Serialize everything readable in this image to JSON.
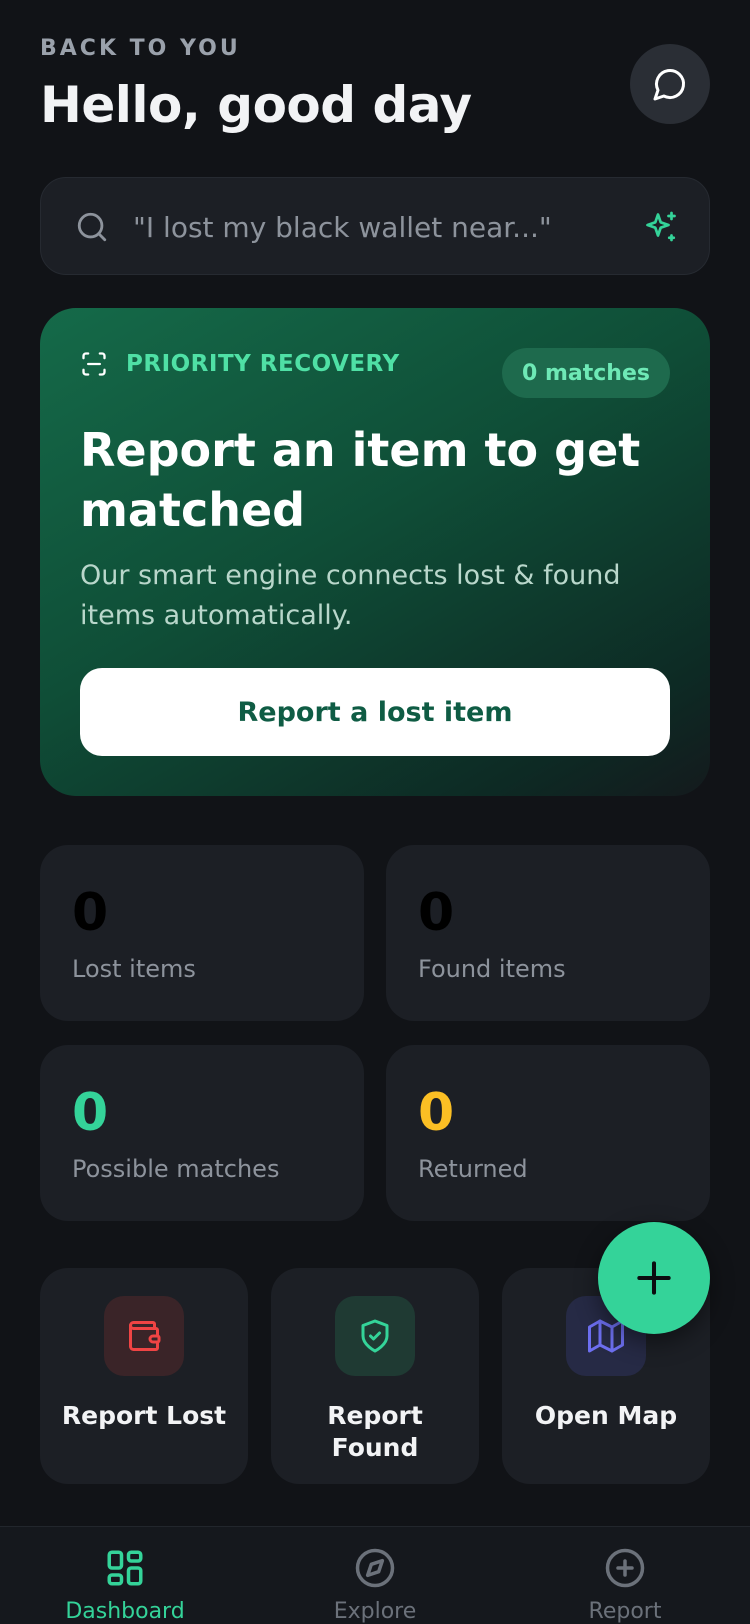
{
  "header": {
    "eyebrow": "BACK TO YOU",
    "title": "Hello, good day",
    "chat_icon": "chat-bubble-icon"
  },
  "search": {
    "placeholder": "\"I lost my black wallet near...\"",
    "search_icon": "search-icon",
    "ai_icon": "sparkle-icon"
  },
  "hero": {
    "tag_icon": "scan-frame-icon",
    "tag_label": "PRIORITY RECOVERY",
    "badge": "0 matches",
    "title": "Report an item to get matched",
    "subtitle": "Our smart engine connects lost & found items automatically.",
    "cta_label": "Report a lost item"
  },
  "stats": [
    {
      "value": "0",
      "label": "Lost items",
      "color": "#000000"
    },
    {
      "value": "0",
      "label": "Found items",
      "color": "#000000"
    },
    {
      "value": "0",
      "label": "Possible matches",
      "color": "#34d399"
    },
    {
      "value": "0",
      "label": "Returned",
      "color": "#fbbf24"
    }
  ],
  "actions": [
    {
      "label": "Report Lost",
      "icon": "wallet-icon",
      "tint": "#3a2428",
      "icon_color": "#ef4444"
    },
    {
      "label": "Report Found",
      "icon": "shield-check-icon",
      "tint": "#1f3a33",
      "icon_color": "#34d399"
    },
    {
      "label": "Open Map",
      "icon": "map-icon",
      "tint": "#262a45",
      "icon_color": "#6d6ff0"
    }
  ],
  "fab": {
    "icon": "plus-icon"
  },
  "nav": [
    {
      "label": "Dashboard",
      "icon": "grid-icon",
      "active": true
    },
    {
      "label": "Explore",
      "icon": "compass-icon",
      "active": false
    },
    {
      "label": "Report",
      "icon": "plus-circle-icon",
      "active": false
    }
  ],
  "colors": {
    "accent": "#34d399",
    "background": "#111317",
    "card": "#1c1f25"
  }
}
